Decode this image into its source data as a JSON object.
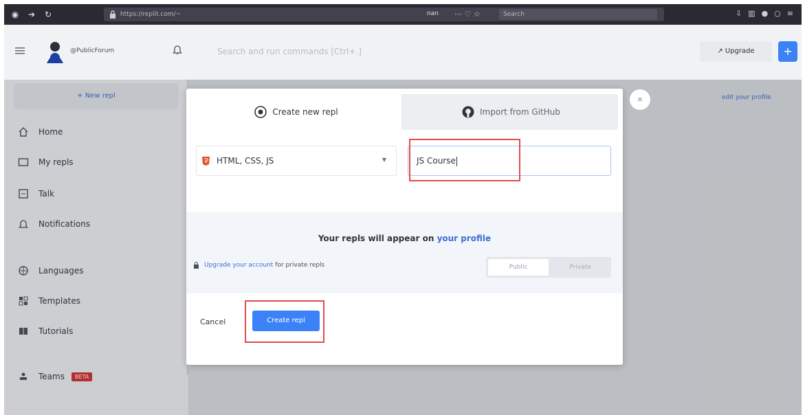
{
  "browser": {
    "url": "https://replit.com/~",
    "mid_text": "nan",
    "search_placeholder": "Search"
  },
  "header": {
    "username": "@PublicForum",
    "command_search": "Search and run commands [Ctrl+.]",
    "upgrade_label": "Upgrade",
    "plus_label": "+"
  },
  "sidebar": {
    "new_repl": "+ New repl",
    "items": [
      {
        "label": "Home",
        "icon": "home-icon"
      },
      {
        "label": "My repls",
        "icon": "folder-icon"
      },
      {
        "label": "Talk",
        "icon": "talk-icon"
      },
      {
        "label": "Notifications",
        "icon": "bell-icon"
      },
      {
        "label": "Languages",
        "icon": "globe-icon"
      },
      {
        "label": "Templates",
        "icon": "templates-icon"
      },
      {
        "label": "Tutorials",
        "icon": "book-icon"
      },
      {
        "label": "Teams",
        "icon": "teams-icon",
        "badge": "BETA"
      }
    ]
  },
  "content": {
    "edit_profile": "edit your profile"
  },
  "modal": {
    "close": "×",
    "tab_create": "Create new repl",
    "tab_import": "Import from GitHub",
    "language": "HTML, CSS, JS",
    "title_value": "JS Course",
    "info_title_prefix": "Your repls will appear on ",
    "info_title_link": "your profile",
    "upgrade_link": "Upgrade your account",
    "upgrade_rest": "for private repls",
    "toggle_public": "Public",
    "toggle_private": "Private",
    "cancel": "Cancel",
    "create": "Create repl"
  },
  "colors": {
    "accent": "#3b82f6",
    "highlight": "#e04b4b"
  }
}
